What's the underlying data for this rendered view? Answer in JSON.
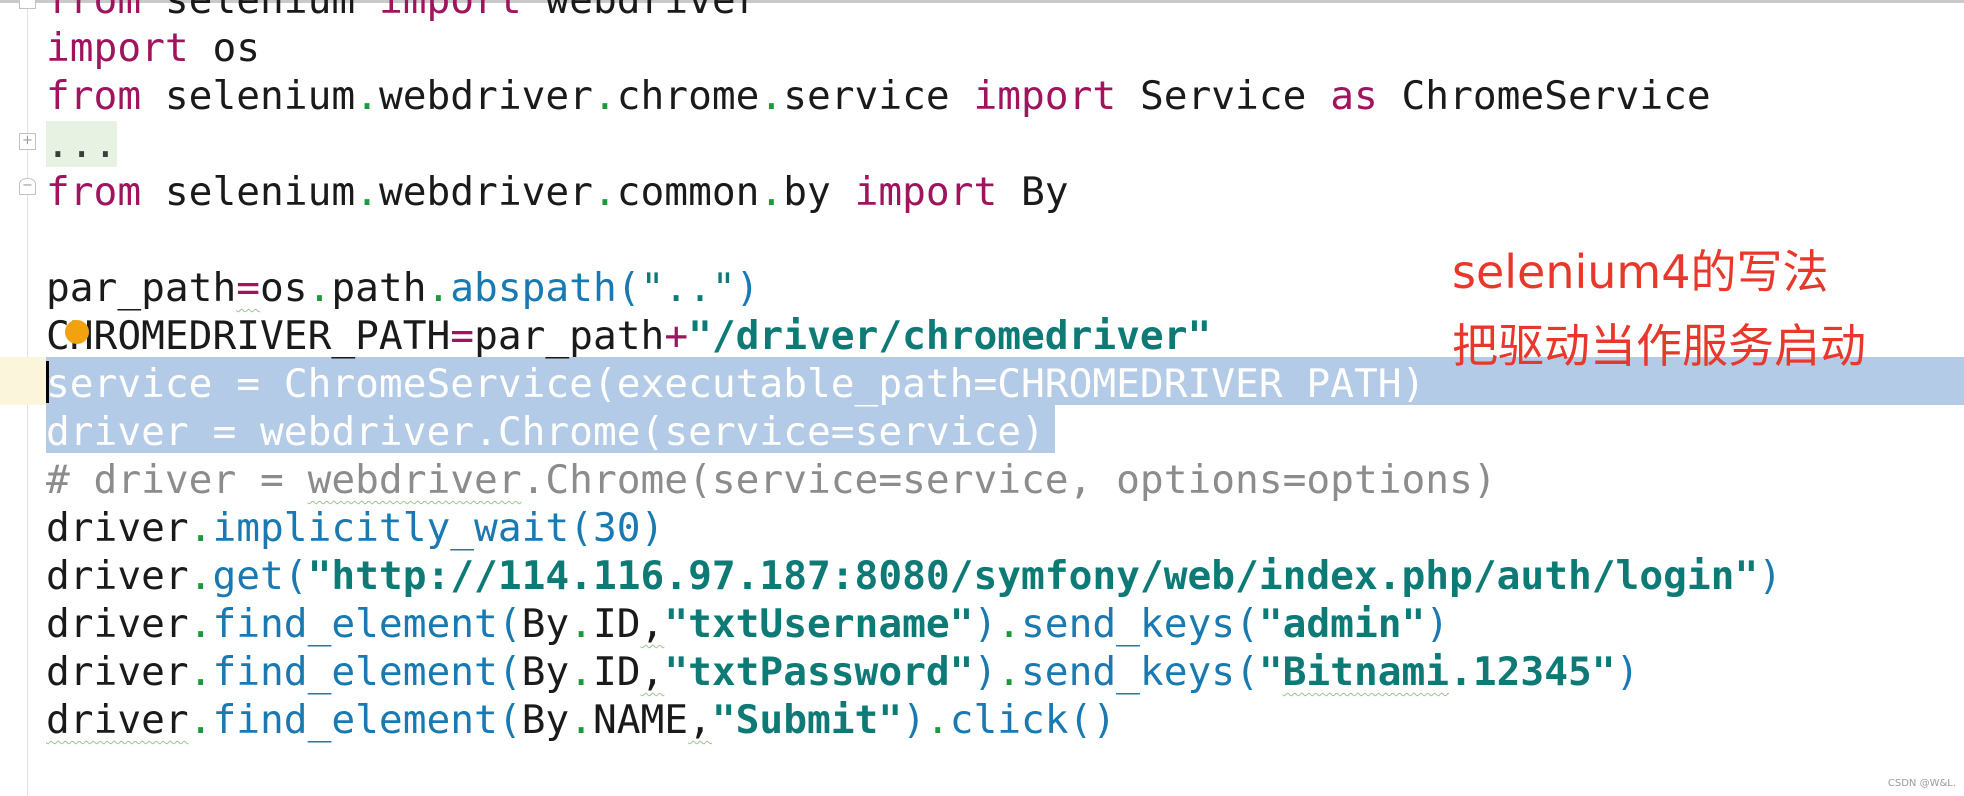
{
  "editor": {
    "fold_placeholder": "...",
    "lines": [
      {
        "raw": "from selenium import webdriver"
      },
      {
        "raw": "import os"
      },
      {
        "raw": "from selenium.webdriver.chrome.service import Service as ChromeService"
      },
      {
        "raw": "..."
      },
      {
        "raw": "from selenium.webdriver.common.by import By"
      },
      {
        "raw": ""
      },
      {
        "raw": "par_path=os.path.abspath(\"..\")"
      },
      {
        "raw": "CHROMEDRIVER_PATH=par_path+\"/driver/chromedriver\""
      },
      {
        "raw": "service = ChromeService(executable_path=CHROMEDRIVER_PATH)"
      },
      {
        "raw": "driver = webdriver.Chrome(service=service)"
      },
      {
        "raw": "# driver = webdriver.Chrome(service=service, options=options)"
      },
      {
        "raw": "driver.implicitly_wait(30)"
      },
      {
        "raw": "driver.get(\"http://114.116.97.187:8080/symfony/web/index.php/auth/login\")"
      },
      {
        "raw": "driver.find_element(By.ID,\"txtUsername\").send_keys(\"admin\")"
      },
      {
        "raw": "driver.find_element(By.ID,\"txtPassword\").send_keys(\"Bitnami.12345\")"
      },
      {
        "raw": "driver.find_element(By.NAME,\"Submit\").click()"
      }
    ],
    "tokens": {
      "from": "from",
      "import": "import",
      "as": "as",
      "selenium": "selenium",
      "webdriver": "webdriver",
      "os": "os",
      "chrome": "chrome",
      "service": "service",
      "Service": "Service",
      "ChromeService": "ChromeService",
      "common": "common",
      "by": "by",
      "By": "By",
      "par_path": "par_path",
      "path": "path",
      "abspath": "abspath",
      "dotdot": "\"..\"",
      "CHROMEDRIVER_PATH": "CHROMEDRIVER_PATH",
      "driver_path_str": "\"/driver/chromedriver\"",
      "executable_path": "executable_path",
      "driver": "driver",
      "Chrome": "Chrome",
      "comment_line": "# driver = webdriver.Chrome(service=service, options=options)",
      "comment_prefix": "# driver = ",
      "comment_webdriver": "webdriver",
      "comment_rest": ".Chrome(service=service, options=options)",
      "implicitly_wait": "implicitly_wait",
      "thirty": "30",
      "get": "get",
      "url": "\"http://114.116.97.187:8080/symfony/web/index.php/auth/login\"",
      "find_element": "find_element",
      "ID": "ID",
      "NAME": "NAME",
      "txtUsername": "\"txtUsername\"",
      "txtPassword": "\"txtPassword\"",
      "send_keys": "send_keys",
      "admin": "\"admin\"",
      "bitnami_q1": "\"",
      "bitnami": "Bitnami",
      "bitnami_rest": ".12345\"",
      "Submit": "\"Submit\"",
      "click": "click"
    }
  },
  "annotation": {
    "line1": "selenium4的写法",
    "line2": "把驱动当作服务启动"
  },
  "watermark": "CSDN @W&L.",
  "colors": {
    "keyword": "#a0135d",
    "dot": "#1a9a3a",
    "function": "#1a79b0",
    "string": "#0d7a76",
    "comment": "#8c8c8c",
    "selection": "#b3cbe6",
    "annotation": "#e8382b",
    "breakpoint": "#f3a20f"
  }
}
